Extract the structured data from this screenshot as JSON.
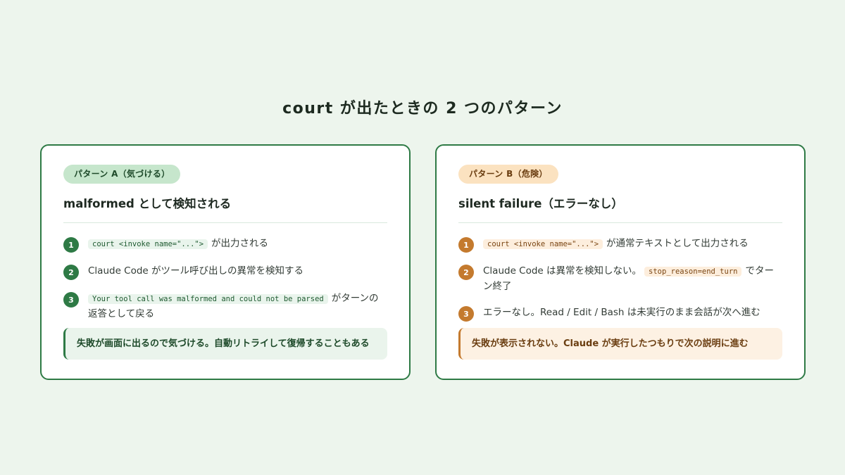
{
  "title": "court が出たときの 2 つのパターン",
  "cards": [
    {
      "badge": "パターン A（気づける）",
      "heading": "malformed として検知される",
      "steps": [
        {
          "num": "1",
          "code": "court <invoke name=\"...\">",
          "text": "が出力される"
        },
        {
          "num": "2",
          "code": "",
          "text": "Claude Code がツール呼び出しの異常を検知する"
        },
        {
          "num": "3",
          "code": "Your tool call was malformed and could not be parsed",
          "text": "がターンの返答として戻る"
        }
      ],
      "callout": "失敗が画面に出るので気づける。自動リトライして復帰することもある"
    },
    {
      "badge": "パターン B（危険）",
      "heading": "silent failure（エラーなし）",
      "steps": [
        {
          "num": "1",
          "code": "court <invoke name=\"...\">",
          "text": "が通常テキストとして出力される"
        },
        {
          "num": "2",
          "pre": "Claude Code は異常を検知しない。",
          "code": "stop_reason=end_turn",
          "text": "でターン終了"
        },
        {
          "num": "3",
          "code": "",
          "text": "エラーなし。Read / Edit / Bash は未実行のまま会話が次へ進む"
        }
      ],
      "callout": "失敗が表示されない。Claude が実行したつもりで次の説明に進む"
    }
  ]
}
